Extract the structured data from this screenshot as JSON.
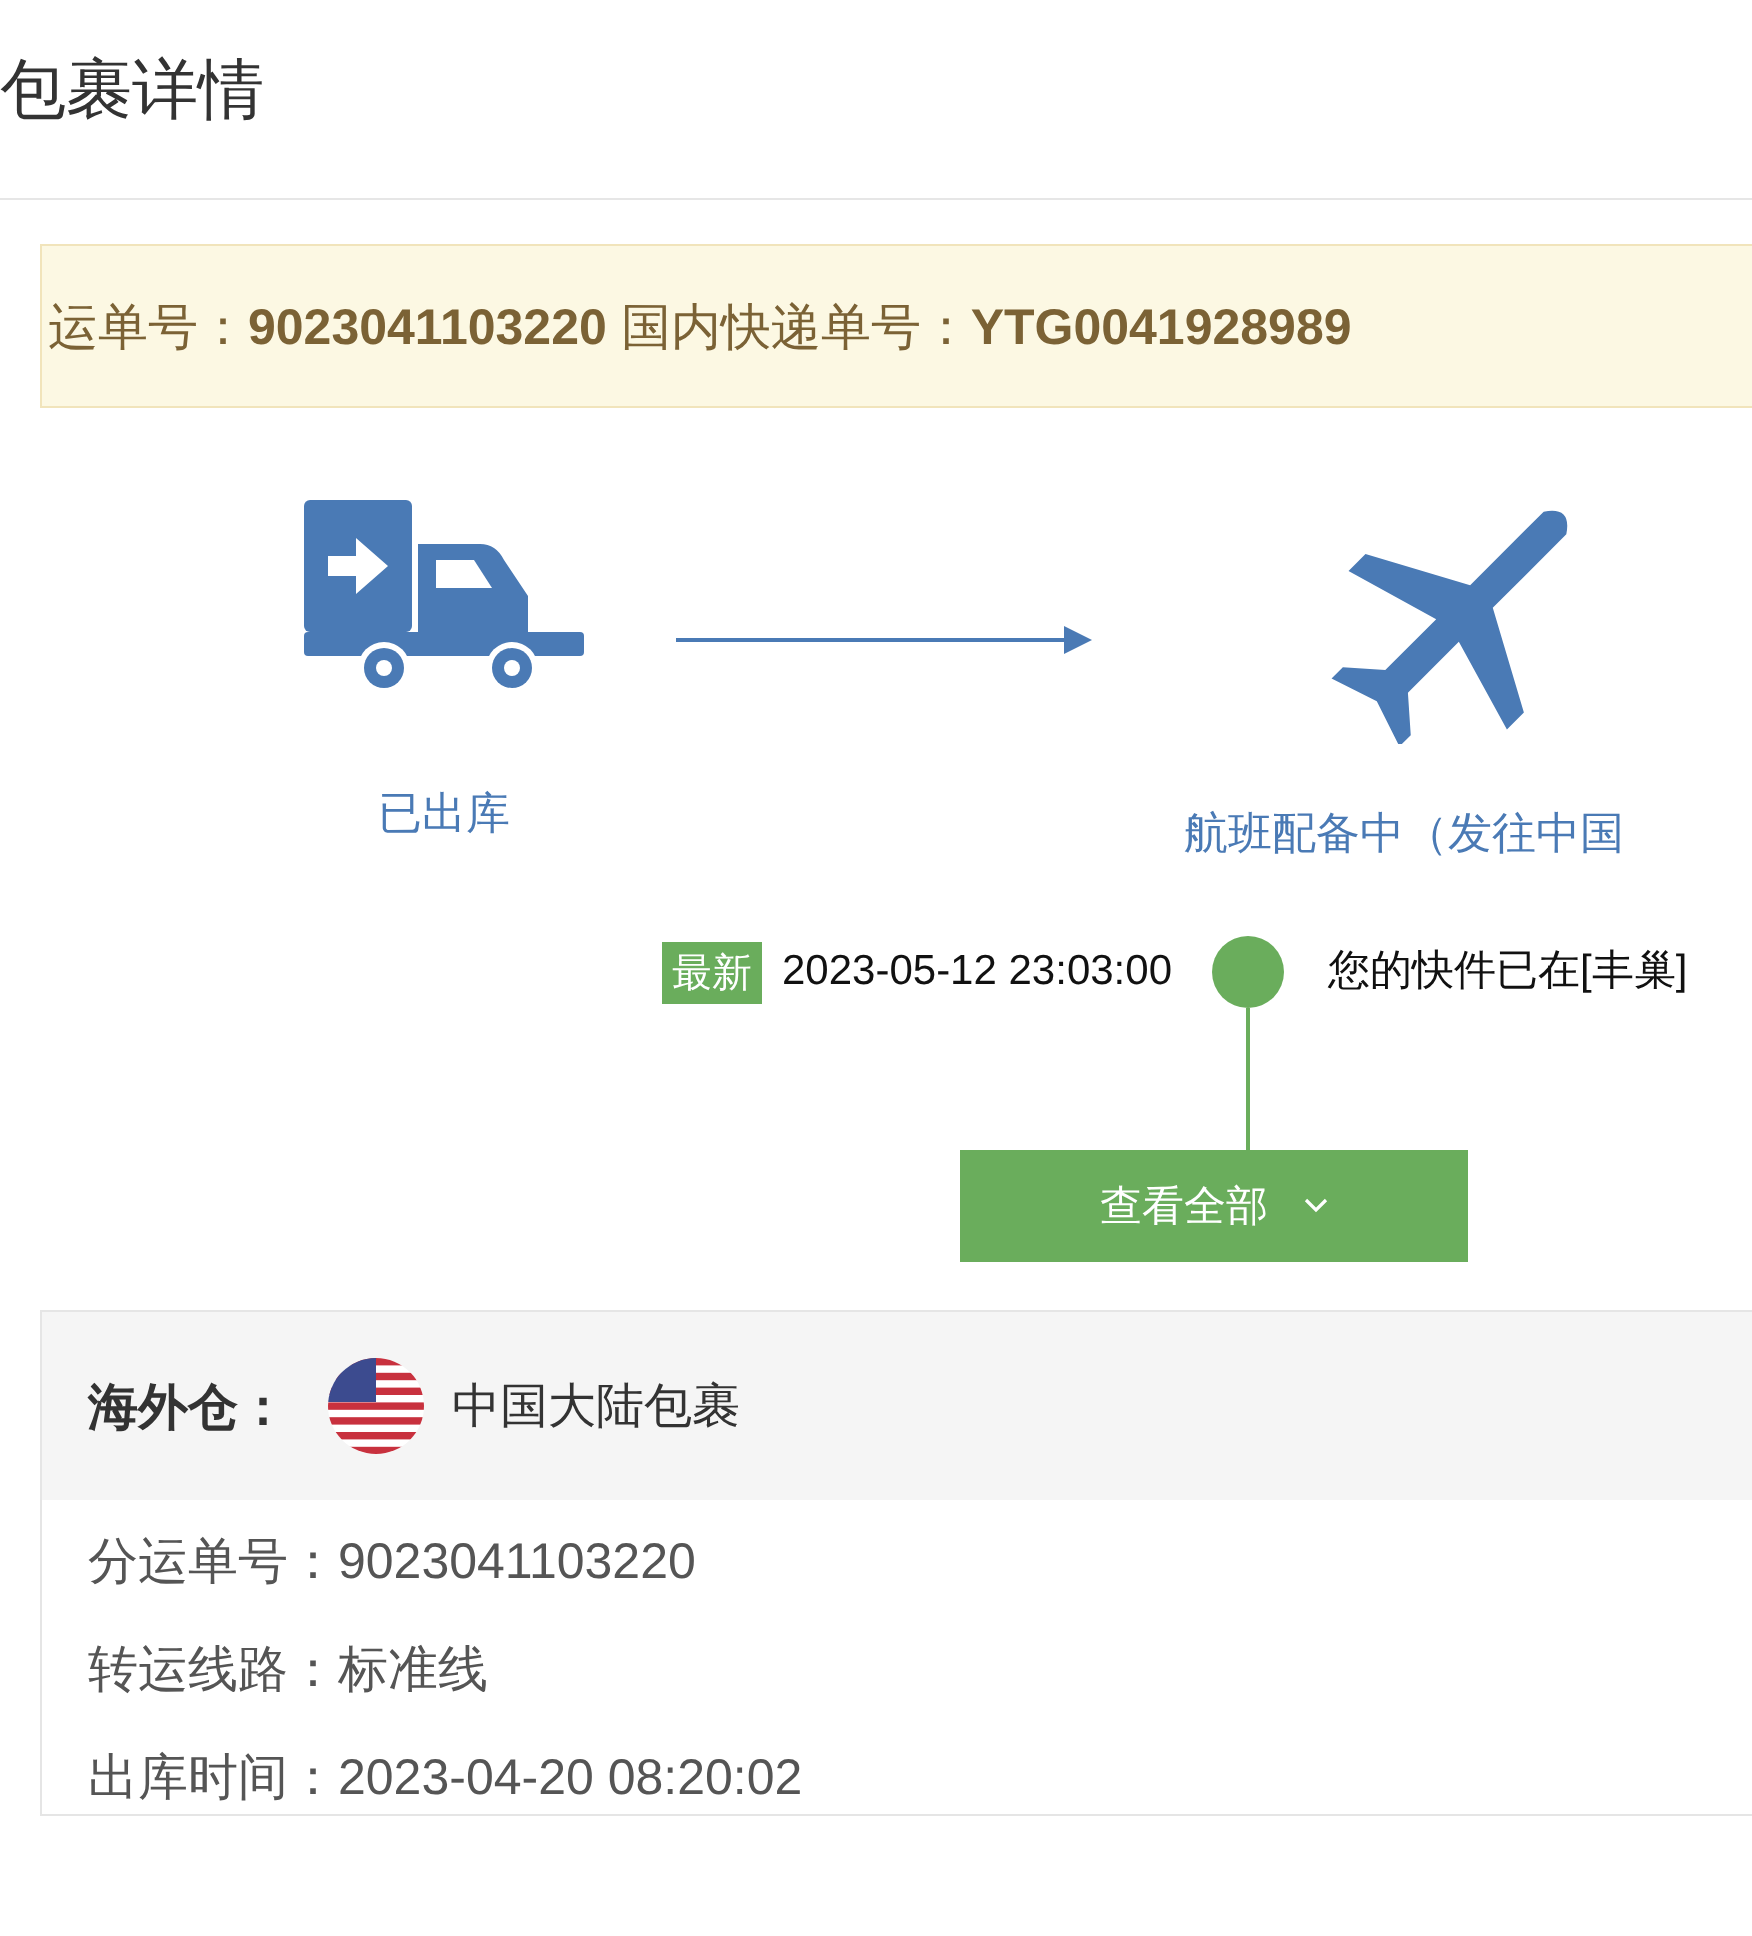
{
  "page_title": "包裹详情",
  "tracking_banner": "运单号：**9023041103220** 国内快递单号：**YTG0041928989**",
  "steps": [
    {
      "kind": "truck",
      "label": "已出库"
    },
    {
      "kind": "plane",
      "label": "航班配备中（发往中国"
    }
  ],
  "latest_event": {
    "badge": "最新",
    "time": "2023-05-12 23:03:00",
    "text": "您的快件已在[丰巢]"
  },
  "view_all_button": "查看全部",
  "warehouse": {
    "label": "海外仓：",
    "name": "中国大陆包裹",
    "fields": [
      {
        "label": "分运单号：",
        "value": "9023041103220"
      },
      {
        "label": "转运线路：",
        "value": "标准线"
      },
      {
        "label": "出库时间：",
        "value": "2023-04-20 08:20:02"
      }
    ]
  }
}
